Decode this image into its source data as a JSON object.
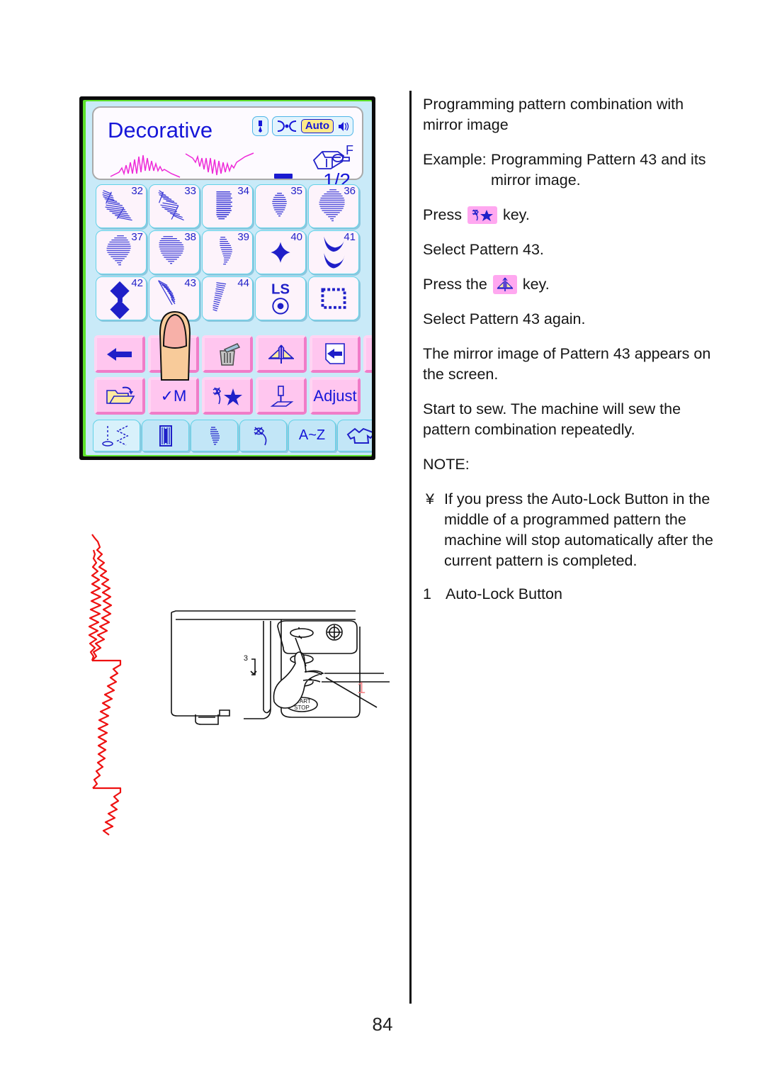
{
  "page": {
    "number": "84"
  },
  "lcd": {
    "title": "Decorative",
    "status_icons": [
      "needle-icon",
      "presser-width-icon",
      "auto-chip",
      "sound-icon"
    ],
    "auto_label": "Auto",
    "foot_letter": "F",
    "page_indicator": "1/2",
    "preview_patterns": [
      "pattern-43",
      "pattern-43-mirrored"
    ],
    "patterns": [
      {
        "num": "32",
        "glyph": "zigzag-step"
      },
      {
        "num": "33",
        "glyph": "zigzag-wave"
      },
      {
        "num": "34",
        "glyph": "dense-block"
      },
      {
        "num": "35",
        "glyph": "small-oval-fill"
      },
      {
        "num": "36",
        "glyph": "large-oval-fill"
      },
      {
        "num": "37",
        "glyph": "leaf-fill"
      },
      {
        "num": "38",
        "glyph": "fan-fill"
      },
      {
        "num": "39",
        "glyph": "crescent"
      },
      {
        "num": "40",
        "glyph": "four-point-star"
      },
      {
        "num": "41",
        "glyph": "double-scallop"
      },
      {
        "num": "42",
        "glyph": "double-diamond"
      },
      {
        "num": "43",
        "glyph": "feather-diagonal"
      },
      {
        "num": "44",
        "glyph": "slanted-zigzag"
      },
      {
        "num": "LS",
        "glyph": "ls-dial"
      },
      {
        "num": "",
        "glyph": "dotted-square"
      }
    ],
    "function_keys_row1": [
      {
        "name": "cursor-left-key",
        "glyph": "arrow-left"
      },
      {
        "name": "minus-key",
        "glyph": "minus"
      },
      {
        "name": "delete-key",
        "glyph": "trash"
      },
      {
        "name": "mirror-key",
        "glyph": "mirror"
      },
      {
        "name": "page-back-key",
        "glyph": "page-arrow-left"
      },
      {
        "name": "page-forward-key",
        "glyph": "page-arrow-right"
      }
    ],
    "function_keys_row2": [
      {
        "name": "file-save-key",
        "glyph": "folder-recall"
      },
      {
        "name": "memory-key",
        "label": "✓M"
      },
      {
        "name": "program-key",
        "glyph": "stitch-star"
      },
      {
        "name": "needle-plate-key",
        "glyph": "needle-plate"
      },
      {
        "name": "adjust-key",
        "label": "Adjust"
      }
    ],
    "tabs": [
      {
        "name": "tab-utility",
        "glyph": "utility-stitch",
        "selected": true
      },
      {
        "name": "tab-buttonhole",
        "glyph": "buttonhole"
      },
      {
        "name": "tab-satin",
        "glyph": "satin-crescent"
      },
      {
        "name": "tab-decorative",
        "glyph": "stitch-swirl"
      },
      {
        "name": "tab-monogram",
        "label": "A~Z"
      },
      {
        "name": "tab-quilting",
        "glyph": "shirt"
      }
    ]
  },
  "content": {
    "heading": "Programming pattern combination with mirror image",
    "example_label": "Example:",
    "example_body": "Programming Pattern 43 and its mirror image.",
    "step_press_prefix": "Press",
    "step_press_suffix": "key.",
    "step_select_43": "Select Pattern 43.",
    "step_press_the_prefix": "Press the",
    "step_press_the_suffix": "key.",
    "step_select_again": "Select Pattern 43 again.",
    "step_mirror_appears": "The mirror image of Pattern 43 appears on the screen.",
    "step_start_sew": "Start to sew. The machine will sew the pattern combination repeatedly.",
    "note_heading": "NOTE:",
    "note_bullet": "¥",
    "note_text": "If you press the Auto-Lock Button  in the middle of a programmed pattern the machine will stop automatically after the current pattern is completed.",
    "ref_number": "1",
    "ref_label": "Auto-Lock Button"
  },
  "figure": {
    "callout_number": "1",
    "thread_number": "3",
    "start_stop_label": "START STOP",
    "stitch_sample": "vertical-red-decorative-stitch"
  },
  "colors": {
    "lcd_background": "#c9eaf8",
    "lcd_frame": "#0b0b0b",
    "lcd_green_edge": "#5de32a",
    "pattern_cell": "#fdf3fb",
    "cell_border": "#63d2e8",
    "function_key": "#ffc6ef",
    "title_blue": "#1616d8",
    "preview_magenta": "#ee2ad8",
    "auto_chip": "#ffe98a",
    "stitch_red": "#ee1111",
    "callout_red": "#f4898d"
  }
}
